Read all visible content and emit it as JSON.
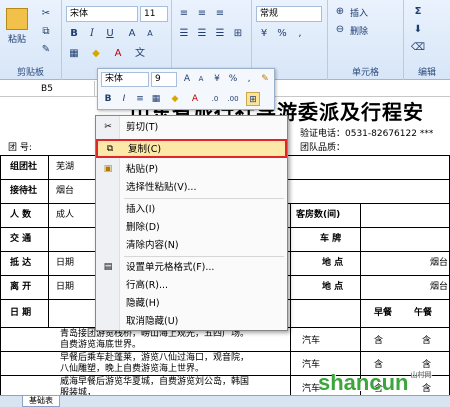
{
  "ribbon": {
    "font_name": "宋体",
    "font_size": "11",
    "number_format": "常规",
    "clipboard_label": "剪贴板",
    "paste_label": "粘贴",
    "insert_label": "插入",
    "delete_label": "删除",
    "cells_label": "单元格",
    "edit_label": "编辑"
  },
  "namebox": {
    "cell": "B5"
  },
  "mini_toolbar": {
    "font_name": "宋体",
    "font_size": "9"
  },
  "sheet": {
    "title": "山东省旅行社导游委派及行程安",
    "line2_left": "团  号:",
    "line2_mid": "验证电话：0531-82676122 ***",
    "line2_right": "团队品质：",
    "rows": [
      {
        "label": "组团社",
        "value": "芜湖"
      },
      {
        "label": "接待社",
        "value": "烟台"
      },
      {
        "label": "人  数",
        "value": "成人",
        "right_label": "客房数(间)"
      },
      {
        "label": "交  通",
        "value": "",
        "right_label": "车    牌"
      },
      {
        "label": "抵  达",
        "value": "日期",
        "right_label": "地  点",
        "right_value": "烟台"
      },
      {
        "label": "离  开",
        "value": "日期",
        "right_label": "地  点",
        "right_value": "烟台"
      }
    ],
    "schedule_header": {
      "date": "日  期",
      "breakfast": "早餐",
      "lunch": "午餐"
    },
    "itinerary": [
      {
        "text": "青岛接团游览栈桥，崂山海上观光，五四广场。",
        "text2": "自费游览海底世界。",
        "meal": "含"
      },
      {
        "text": "早餐后乘车赴蓬莱，游览八仙过海口，观音院，",
        "text2": "八仙雕塑，晚上自费游览海上世界。",
        "transport": "汽车",
        "meal": "含",
        "meal2": "含"
      },
      {
        "text": "威海早餐后游览华夏城，自费游览刘公岛，韩国",
        "text2": "服装城，",
        "transport": "汽车",
        "meal": "含",
        "meal2": "含"
      }
    ],
    "transport_first": "汽车",
    "meal_first": "含"
  },
  "sheet_tab": "基础表",
  "context_menu": {
    "items": [
      {
        "label": "剪切(T)",
        "icon": "scissors-icon"
      },
      {
        "label": "复制(C)",
        "icon": "copy-icon"
      },
      {
        "label": "粘贴(P)",
        "icon": "paste-icon"
      },
      {
        "label": "选择性粘贴(V)...",
        "icon": ""
      },
      {
        "label": "插入(I)",
        "icon": ""
      },
      {
        "label": "删除(D)",
        "icon": ""
      },
      {
        "label": "清除内容(N)",
        "icon": ""
      },
      {
        "label": "设置单元格格式(F)...",
        "icon": "format-cells-icon"
      },
      {
        "label": "行高(R)...",
        "icon": ""
      },
      {
        "label": "隐藏(H)",
        "icon": ""
      },
      {
        "label": "取消隐藏(U)",
        "icon": ""
      }
    ]
  },
  "watermark": {
    "text": "shancun",
    "sub": "山村网"
  }
}
